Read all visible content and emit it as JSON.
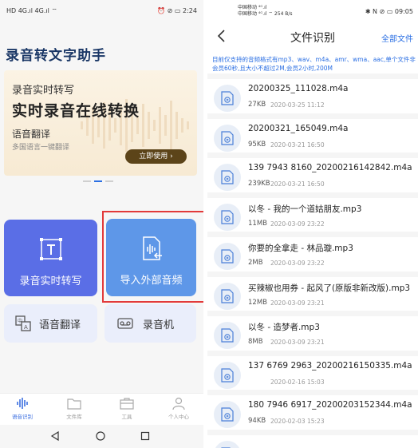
{
  "left": {
    "status_bar": {
      "left": "HD 4G.ıl 4G.ıl ⌔",
      "right": "⏰ ⊘ ▭ 2:24"
    },
    "app_title": "录音转文字助手",
    "banner": {
      "small": "录音实时转写",
      "big": "实时录音在线转换",
      "sub": "语音翻译",
      "sub2": "多国语言一键翻译",
      "button": "立即使用 ›"
    },
    "cards": {
      "realtime": "录音实时转写",
      "import": "导入外部音频",
      "translate": "语音翻译",
      "recorder": "录音机"
    },
    "tabs": [
      "语音识别",
      "文件库",
      "工具",
      "个人中心"
    ]
  },
  "right": {
    "status_bar": {
      "left_line1": "中国移动 ⁴ᴳ.ıl",
      "left_line2": "中国移动 ⁴ᴳ.ıl ⌔ 254 B/s",
      "right": "✱ N ⊘ ▭ 09:05"
    },
    "title": "文件识别",
    "all_files": "全部文件",
    "notice": "目前仅支持的音频格式有mp3、wav、m4a、amr、wma、aac,单个文件非会员60秒,且大小不超过2M,会员2小时,200M",
    "files": [
      {
        "name": "20200325_111028.m4a",
        "size": "27KB",
        "date": "2020-03-25 11:12"
      },
      {
        "name": "20200321_165049.m4a",
        "size": "95KB",
        "date": "2020-03-21 16:50"
      },
      {
        "name": "139 7943 8160_20200216142842.m4a",
        "size": "239KB",
        "date": "2020-03-21 16:50"
      },
      {
        "name": "以冬 - 我的一个道姑朋友.mp3",
        "size": "11MB",
        "date": "2020-03-09 23:22"
      },
      {
        "name": "你要的全拿走 - 林品璇.mp3",
        "size": "2MB",
        "date": "2020-03-09 23:22"
      },
      {
        "name": "买辣椒也用券 - 起风了(原版非新改版).mp3",
        "size": "12MB",
        "date": "2020-03-09 23:21"
      },
      {
        "name": "以冬 - 造梦者.mp3",
        "size": "8MB",
        "date": "2020-03-09 23:21"
      },
      {
        "name": "137 6769 2963_20200216150335.m4a",
        "size": "",
        "date": "2020-02-16 15:03"
      },
      {
        "name": "180 7946 6917_20200203152344.m4a",
        "size": "94KB",
        "date": "2020-02-03 15:23"
      },
      {
        "name": "",
        "size": "",
        "date": ""
      }
    ]
  },
  "colors": {
    "accent": "#2b6fe3",
    "card_purple": "#5a6ee6",
    "card_blue": "#5e97e8",
    "highlight": "#e23a3a",
    "banner_button": "#5c4419"
  }
}
